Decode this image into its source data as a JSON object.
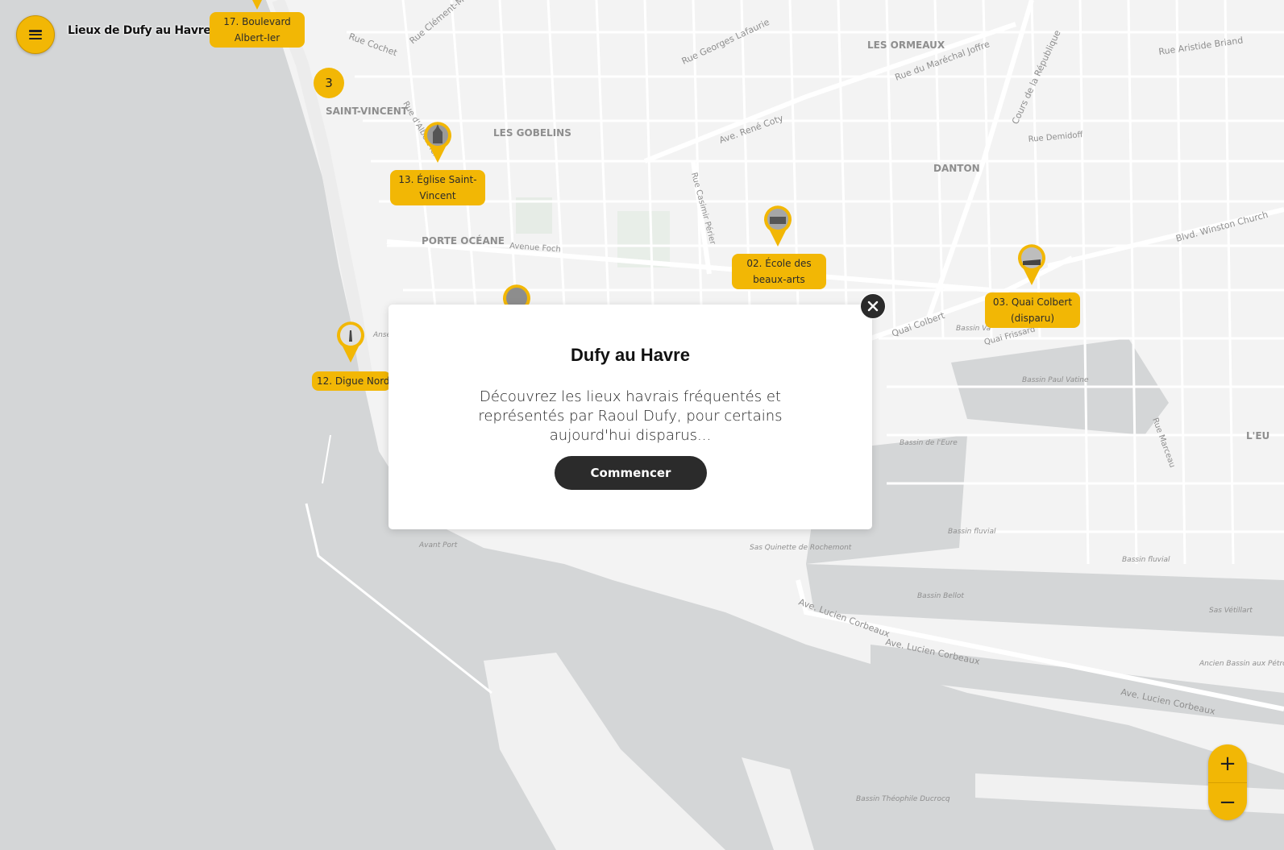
{
  "app": {
    "title": "Lieux de Dufy au Havre"
  },
  "map": {
    "districts": [
      {
        "name": "SAINT-VINCENT"
      },
      {
        "name": "LES GOBELINS"
      },
      {
        "name": "PORTE OCÉANE"
      },
      {
        "name": "LES ORMEAUX"
      },
      {
        "name": "DANTON"
      },
      {
        "name": "L'EU"
      }
    ],
    "streets": [
      "Rue Cochet",
      "Rue Clément-Marie",
      "Rue Georges Lafaurie",
      "Rue du Maréchal Joffre",
      "Cours de la République",
      "Rue Aristide Briand",
      "Rue Demidoff",
      "Ave. René Coty",
      "Rue Casimir Périer",
      "Avenue Foch",
      "Blvd. Winston Church",
      "Quai Colbert",
      "Quai Frissard",
      "Ave. Lucien Corbeaux",
      "Rue Marceau",
      "Rue d'Albert Ier"
    ],
    "water_labels": [
      "Bassin Paul Vatine",
      "Bassin de l'Eure",
      "Bassin fluvial",
      "Bassin fluvial",
      "Bassin Bellot",
      "Sas Vétillart",
      "Ancien Bassin aux Pétroles",
      "Sas Quinette de Rochemont",
      "Avant Port",
      "Bassin Théophile Ducrocq",
      "Anse",
      "Bassin Va"
    ],
    "cluster_count": "3",
    "places": [
      {
        "label": "17. Boulevard Albert-Ier"
      },
      {
        "label": "13. Église Saint-Vincent"
      },
      {
        "label": "02. École des beaux-arts"
      },
      {
        "label": "03. Quai Colbert (disparu)"
      },
      {
        "label": "12. Digue Nord"
      }
    ]
  },
  "modal": {
    "title": "Dufy au Havre",
    "text": "Découvrez les lieux havrais fréquentés et représentés par Raoul Dufy, pour certains aujourd'hui disparus...",
    "start_label": "Commencer"
  },
  "controls": {
    "zoom_in": "+",
    "zoom_out": "−"
  },
  "colors": {
    "accent": "#f2b705",
    "dark": "#2b2b2b",
    "sea": "#d4d6d7",
    "land": "#f3f3f3",
    "streets": "#ffffff"
  },
  "icons": [
    "menu-icon",
    "close-icon",
    "zoom-in-icon",
    "zoom-out-icon",
    "place-pin-icon"
  ]
}
